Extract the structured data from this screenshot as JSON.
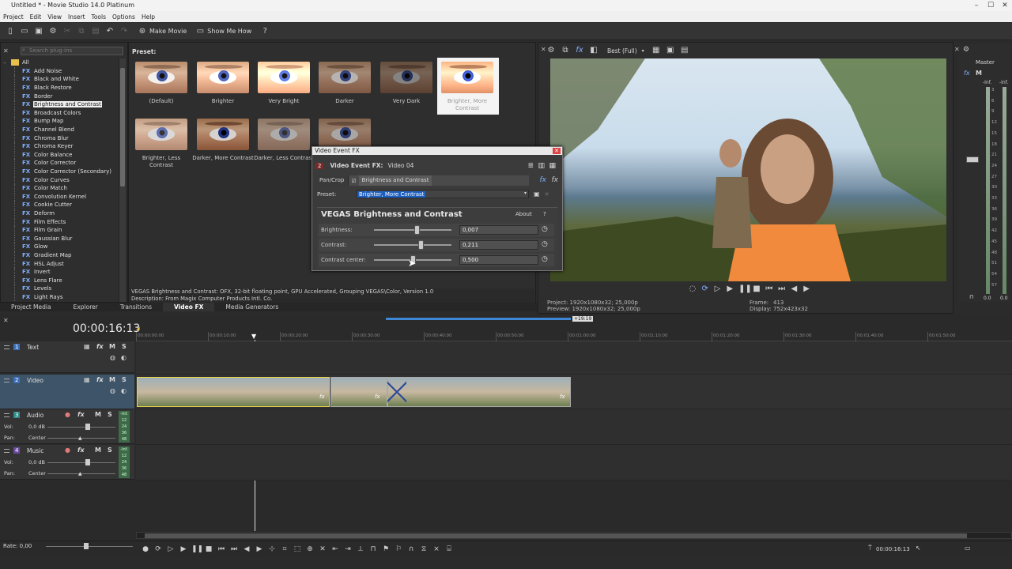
{
  "window": {
    "title": "Untitled * - Movie Studio 14.0 Platinum"
  },
  "menu": [
    "Project",
    "Edit",
    "View",
    "Insert",
    "Tools",
    "Options",
    "Help"
  ],
  "toolbar": {
    "make_movie": "Make Movie",
    "show_me_how": "Show Me How"
  },
  "plugins": {
    "search_placeholder": "Search plug-ins",
    "root": "All",
    "items": [
      "Add Noise",
      "Black and White",
      "Black Restore",
      "Border",
      "Brightness and Contrast",
      "Broadcast Colors",
      "Bump Map",
      "Channel Blend",
      "Chroma Blur",
      "Chroma Keyer",
      "Color Balance",
      "Color Corrector",
      "Color Corrector (Secondary)",
      "Color Curves",
      "Color Match",
      "Convolution Kernel",
      "Cookie Cutter",
      "Deform",
      "Film Effects",
      "Film Grain",
      "Gaussian Blur",
      "Glow",
      "Gradient Map",
      "HSL Adjust",
      "Invert",
      "Lens Flare",
      "Levels",
      "Light Rays"
    ],
    "selected_index": 4
  },
  "presets": {
    "label": "Preset:",
    "items": [
      "(Default)",
      "Brighter",
      "Very Bright",
      "Darker",
      "Very Dark",
      "Brighter, More Contrast",
      "Brighter, Less Contrast",
      "Darker, More Contrast",
      "Darker, Less Contrast",
      ""
    ]
  },
  "plugin_desc": {
    "line1": "VEGAS Brightness and Contrast: OFX, 32-bit floating point, GPU Accelerated, Grouping VEGAS\\Color, Version 1.0",
    "line2": "Description: From Magix Computer Products Intl. Co."
  },
  "tabs": [
    "Project Media",
    "Explorer",
    "Transitions",
    "Video FX",
    "Media Generators"
  ],
  "active_tab": "Video FX",
  "preview": {
    "quality": "Best (Full)",
    "project": "Project:    1920x1080x32; 25,000p",
    "preview": "Preview:   1920x1080x32; 25,000p",
    "frame_label": "Frame:",
    "frame_value": "413",
    "display_label": "Display:",
    "display_value": "752x423x32"
  },
  "master": {
    "label": "Master",
    "inf": "-Inf.",
    "scale": [
      "3",
      "6",
      "9",
      "12",
      "15",
      "18",
      "21",
      "24",
      "27",
      "30",
      "33",
      "36",
      "39",
      "42",
      "45",
      "48",
      "51",
      "54",
      "57"
    ],
    "left_val": "0.0",
    "right_val": "0.0"
  },
  "fx_dialog": {
    "title": "Video Event FX",
    "header_num": "2",
    "header": "Video Event FX:",
    "header_sub": "Video 04",
    "chain": [
      "Pan/Crop",
      "Brightness and Contrast"
    ],
    "preset_label": "Preset:",
    "preset_value": "Brighter, More Contrast",
    "plugin_title": "VEGAS Brightness and Contrast",
    "about": "About",
    "help": "?",
    "params": [
      {
        "label": "Brightness:",
        "value": "0,007",
        "pos": 0.55
      },
      {
        "label": "Contrast:",
        "value": "0,211",
        "pos": 0.61
      },
      {
        "label": "Contrast center:",
        "value": "0,500",
        "pos": 0.5
      }
    ]
  },
  "timeline": {
    "timecode": "00:00:16:13",
    "region_end": "+19:19",
    "ruler_ticks": [
      "00:00:00:00",
      "00:00:10:00",
      "00:00:20:00",
      "00:00:30:00",
      "00:00:40:00",
      "00:00:50:00",
      "00:01:00:00",
      "00:01:10:00",
      "00:01:20:00",
      "00:01:30:00",
      "00:01:40:00",
      "00:01:50:00"
    ],
    "tracks": [
      {
        "num": "1",
        "name": "Text"
      },
      {
        "num": "2",
        "name": "Video"
      },
      {
        "num": "3",
        "name": "Audio",
        "vol_label": "Vol:",
        "vol": "0,0 dB",
        "pan_label": "Pan:",
        "pan": "Center"
      },
      {
        "num": "4",
        "name": "Music",
        "vol_label": "Vol:",
        "vol": "0,0 dB",
        "pan_label": "Pan:",
        "pan": "Center"
      }
    ],
    "meter_labels": [
      "-Inf.",
      "12",
      "24",
      "36",
      "48"
    ]
  },
  "status": {
    "rate": "Rate: 0,00",
    "end_timecode": "00:00:16:13"
  },
  "colors": {
    "accent": "#3d87d6",
    "selection": "#1e5fbf",
    "dialog_bg": "#3b3b3b"
  }
}
